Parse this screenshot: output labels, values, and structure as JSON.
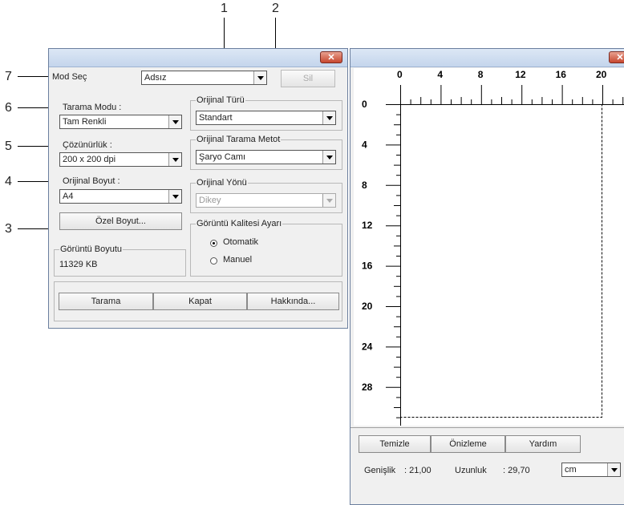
{
  "callouts": [
    "1",
    "2",
    "3",
    "4",
    "5",
    "6",
    "7"
  ],
  "left_window": {
    "close_glyph": "✕",
    "mod_sec_label": "Mod Seç",
    "mod_sec_value": "Adsız",
    "sil_button": "Sil",
    "tarama_modu_label": "Tarama Modu :",
    "tarama_modu_value": "Tam Renkli",
    "cozunurluk_label": "Çözünürlük :",
    "cozunurluk_value": "200 x 200 dpi",
    "orijinal_boyut_label": "Orijinal Boyut :",
    "orijinal_boyut_value": "A4",
    "ozel_boyut_button": "Özel Boyut...",
    "goruntu_boyutu_title": "Görüntü Boyutu",
    "goruntu_boyutu_value": "11329 KB",
    "orijinal_turu_title": "Orijinal Türü",
    "orijinal_turu_value": "Standart",
    "tarama_metot_title": "Orijinal Tarama Metot",
    "tarama_metot_value": "Şaryo Camı",
    "orijinal_yonu_title": "Orijinal Yönü",
    "orijinal_yonu_value": "Dikey",
    "kalite_title": "Görüntü Kalitesi Ayarı",
    "radio_otomatik": "Otomatik",
    "radio_manuel": "Manuel",
    "tarama_button": "Tarama",
    "kapat_button": "Kapat",
    "hakkinda_button": "Hakkında..."
  },
  "right_window": {
    "close_glyph": "✕",
    "ruler_top_labels": [
      "0",
      "4",
      "8",
      "12",
      "16",
      "20"
    ],
    "ruler_left_labels": [
      "0",
      "4",
      "8",
      "12",
      "16",
      "20",
      "24",
      "28"
    ],
    "temizle_button": "Temizle",
    "onizleme_button": "Önizleme",
    "yardim_button": "Yardım",
    "genislik_label": "Genişlik",
    "genislik_value": ": 21,00",
    "uzunluk_label": "Uzunluk",
    "uzunluk_value": ": 29,70",
    "unit_value": "cm"
  }
}
